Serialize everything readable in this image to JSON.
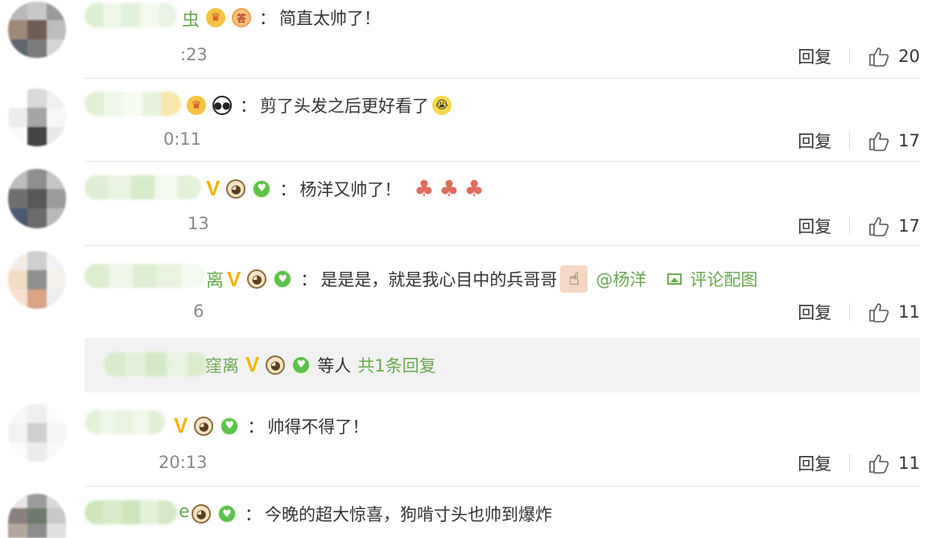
{
  "comments": [
    {
      "name_tail": "虫",
      "badges": [
        "crown-icon",
        "seal-icon"
      ],
      "text": "简直太帅了！",
      "time": ":23",
      "reply": "回复",
      "likes": "20"
    },
    {
      "name_tail": "",
      "badges": [
        "crown-icon",
        "panda-icon"
      ],
      "text": "剪了头发之后更好看了",
      "time": "0:11",
      "reply": "回复",
      "likes": "17"
    },
    {
      "name_tail": "",
      "badge_v": "V",
      "text": "杨洋又帅了！",
      "time": "13",
      "reply": "回复",
      "likes": "17"
    },
    {
      "name_tail": "离",
      "badge_v": "V",
      "text": "是是是，就是我心目中的兵哥哥",
      "mention": "@杨洋",
      "pic_link": "评论配图",
      "time": "6",
      "reply": "回复",
      "likes": "11"
    },
    {
      "name_tail": "",
      "badge_v": "V",
      "text": "帅得不得了！",
      "time": "20:13",
      "reply": "回复",
      "likes": "11"
    },
    {
      "name_tail": "e",
      "text": "今晚的超大惊喜，狗啃寸头也帅到爆炸"
    }
  ],
  "reply_bar": {
    "name_tail": "窪离",
    "badge_v": "V",
    "suffix": "等人",
    "link": "共1条回复"
  },
  "colors": {
    "link_green": "#6aa84f",
    "vip_gold": "#f4b400",
    "divider": "#e6e6e6",
    "reply_bg": "#f2f2f2"
  }
}
